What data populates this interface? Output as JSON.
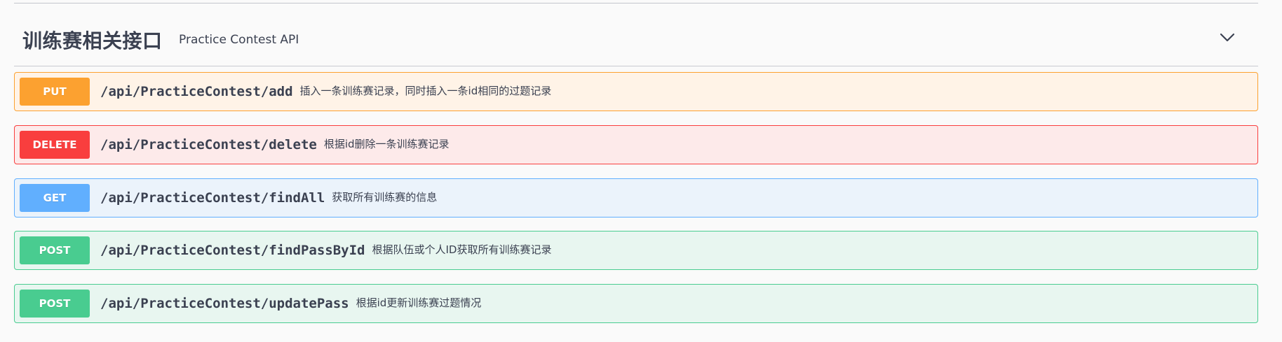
{
  "section": {
    "title": "训练赛相关接口",
    "description": "Practice Contest API"
  },
  "colors": {
    "put": "#fca130",
    "put_bg": "#fff3e7",
    "put_border": "#fca130",
    "delete": "#f93e3e",
    "delete_bg": "#fdeaea",
    "delete_border": "#f93e3e",
    "get": "#61affe",
    "get_bg": "#ebf3fb",
    "get_border": "#61affe",
    "post": "#49cc90",
    "post_bg": "#e8f6f0",
    "post_border": "#49cc90"
  },
  "operations": [
    {
      "method": "PUT",
      "path": "/api/PracticeContest/add",
      "summary": "插入一条训练赛记录，同时插入一条id相同的过题记录"
    },
    {
      "method": "DELETE",
      "path": "/api/PracticeContest/delete",
      "summary": "根据id删除一条训练赛记录"
    },
    {
      "method": "GET",
      "path": "/api/PracticeContest/findAll",
      "summary": "获取所有训练赛的信息"
    },
    {
      "method": "POST",
      "path": "/api/PracticeContest/findPassById",
      "summary": "根据队伍或个人ID获取所有训练赛记录"
    },
    {
      "method": "POST",
      "path": "/api/PracticeContest/updatePass",
      "summary": "根据id更新训练赛过题情况"
    }
  ]
}
